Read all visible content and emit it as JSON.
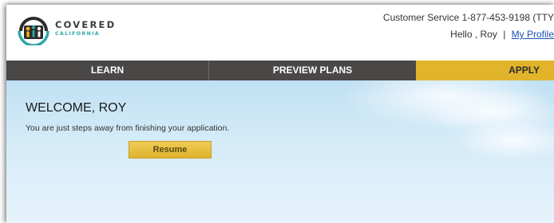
{
  "header": {
    "logo": {
      "line1": "COVERED",
      "line2": "CALIFORNIA"
    },
    "customer_service": "Customer Service 1-877-453-9198 (TTY",
    "greeting": "Hello , Roy",
    "separator": "|",
    "profile_link": "My Profile"
  },
  "nav": {
    "items": [
      {
        "label": "LEARN"
      },
      {
        "label": "PREVIEW PLANS"
      },
      {
        "label": "APPLY",
        "active": true
      }
    ]
  },
  "main": {
    "welcome": "WELCOME, ROY",
    "message": "You are just steps away from finishing your application.",
    "resume_label": "Resume"
  },
  "colors": {
    "nav_bg": "#4a4747",
    "apply_active": "#e2b42c",
    "brand_teal": "#2ea8a7",
    "link": "#1a52b8",
    "sky": "#cfe8f6"
  }
}
